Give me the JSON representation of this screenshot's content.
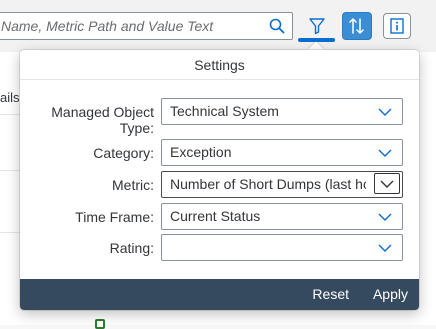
{
  "search": {
    "placeholder": "Name, Metric Path and Value Text"
  },
  "toolbar": {
    "filter_icon": "filter-icon",
    "sort_icon": "sort-icon",
    "info_icon": "info-icon",
    "accent": "#0a6ed1"
  },
  "background": {
    "column_label": "ails"
  },
  "settings": {
    "title": "Settings",
    "fields": [
      {
        "label": "Managed Object Type:",
        "value": "Technical System"
      },
      {
        "label": "Category:",
        "value": "Exception"
      },
      {
        "label": "Metric:",
        "value": "Number of Short Dumps (last hc"
      },
      {
        "label": "Time Frame:",
        "value": "Current Status"
      },
      {
        "label": "Rating:",
        "value": ""
      }
    ],
    "reset_label": "Reset",
    "apply_label": "Apply",
    "footer_color": "#354a5f"
  }
}
